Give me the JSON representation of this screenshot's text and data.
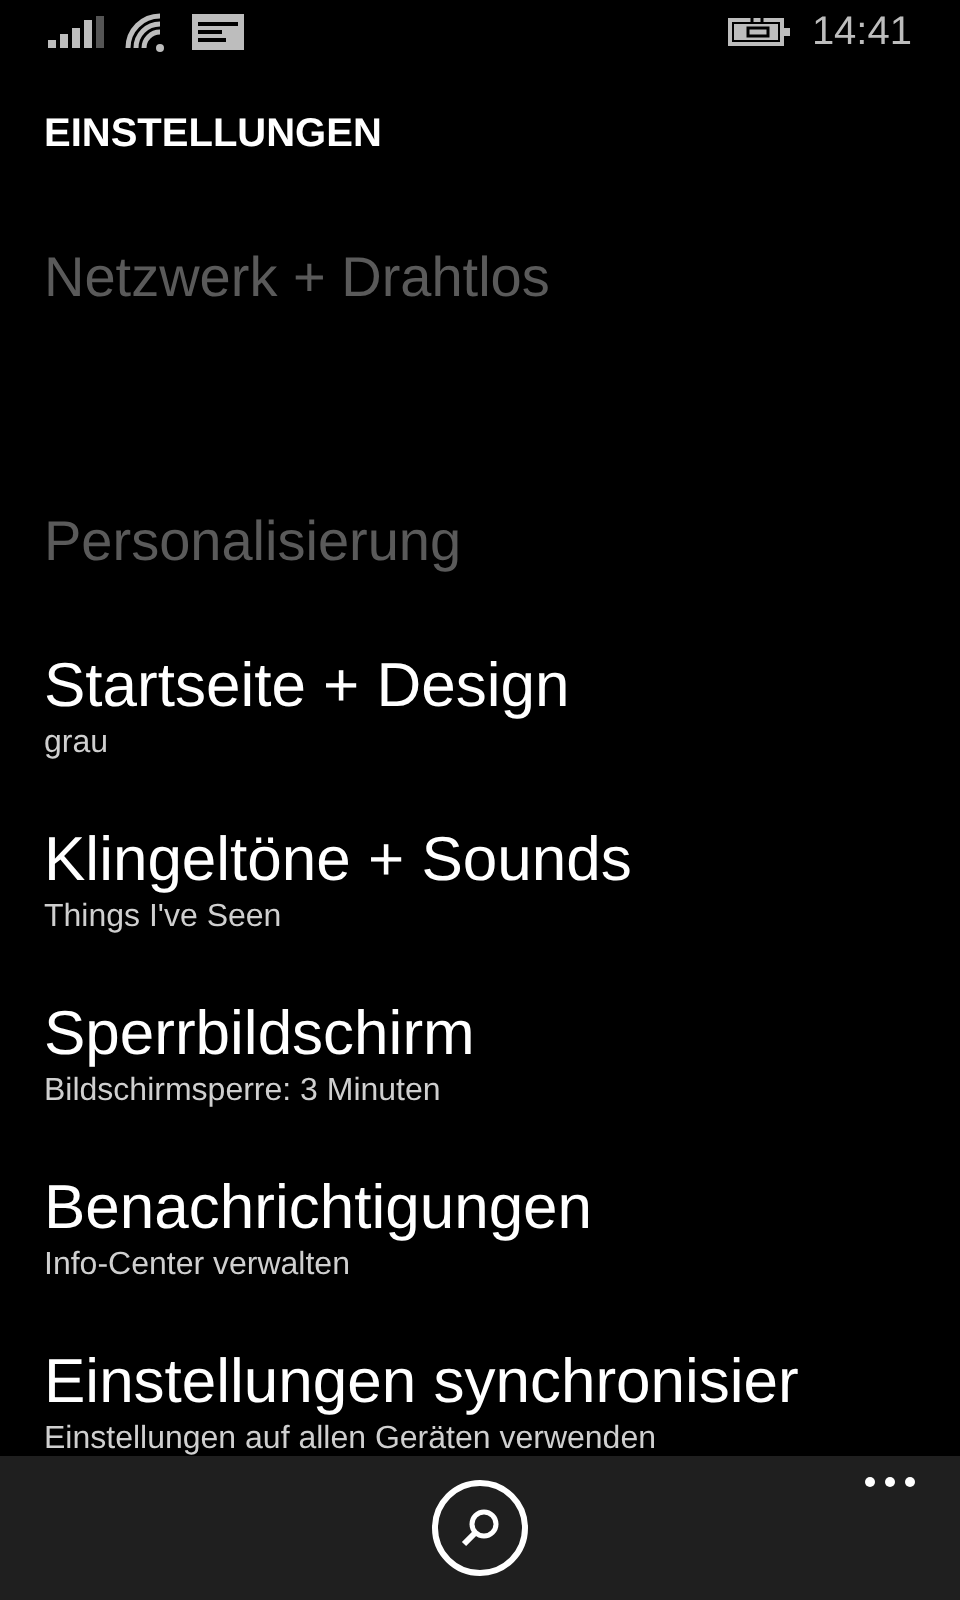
{
  "status_bar": {
    "time": "14:41"
  },
  "page_title": "EINSTELLUNGEN",
  "sections": [
    {
      "header": "Netzwerk + Drahtlos"
    },
    {
      "header": "Personalisierung",
      "items": [
        {
          "title": "Startseite + Design",
          "subtitle": "grau"
        },
        {
          "title": "Klingeltöne + Sounds",
          "subtitle": "Things I've Seen"
        },
        {
          "title": "Sperrbildschirm",
          "subtitle": "Bildschirmsperre: 3 Minuten"
        },
        {
          "title": "Benachrichtigungen",
          "subtitle": "Info-Center verwalten"
        },
        {
          "title": "Einstellungen synchronisier",
          "subtitle": "Einstellungen auf allen Geräten verwenden"
        }
      ]
    }
  ]
}
